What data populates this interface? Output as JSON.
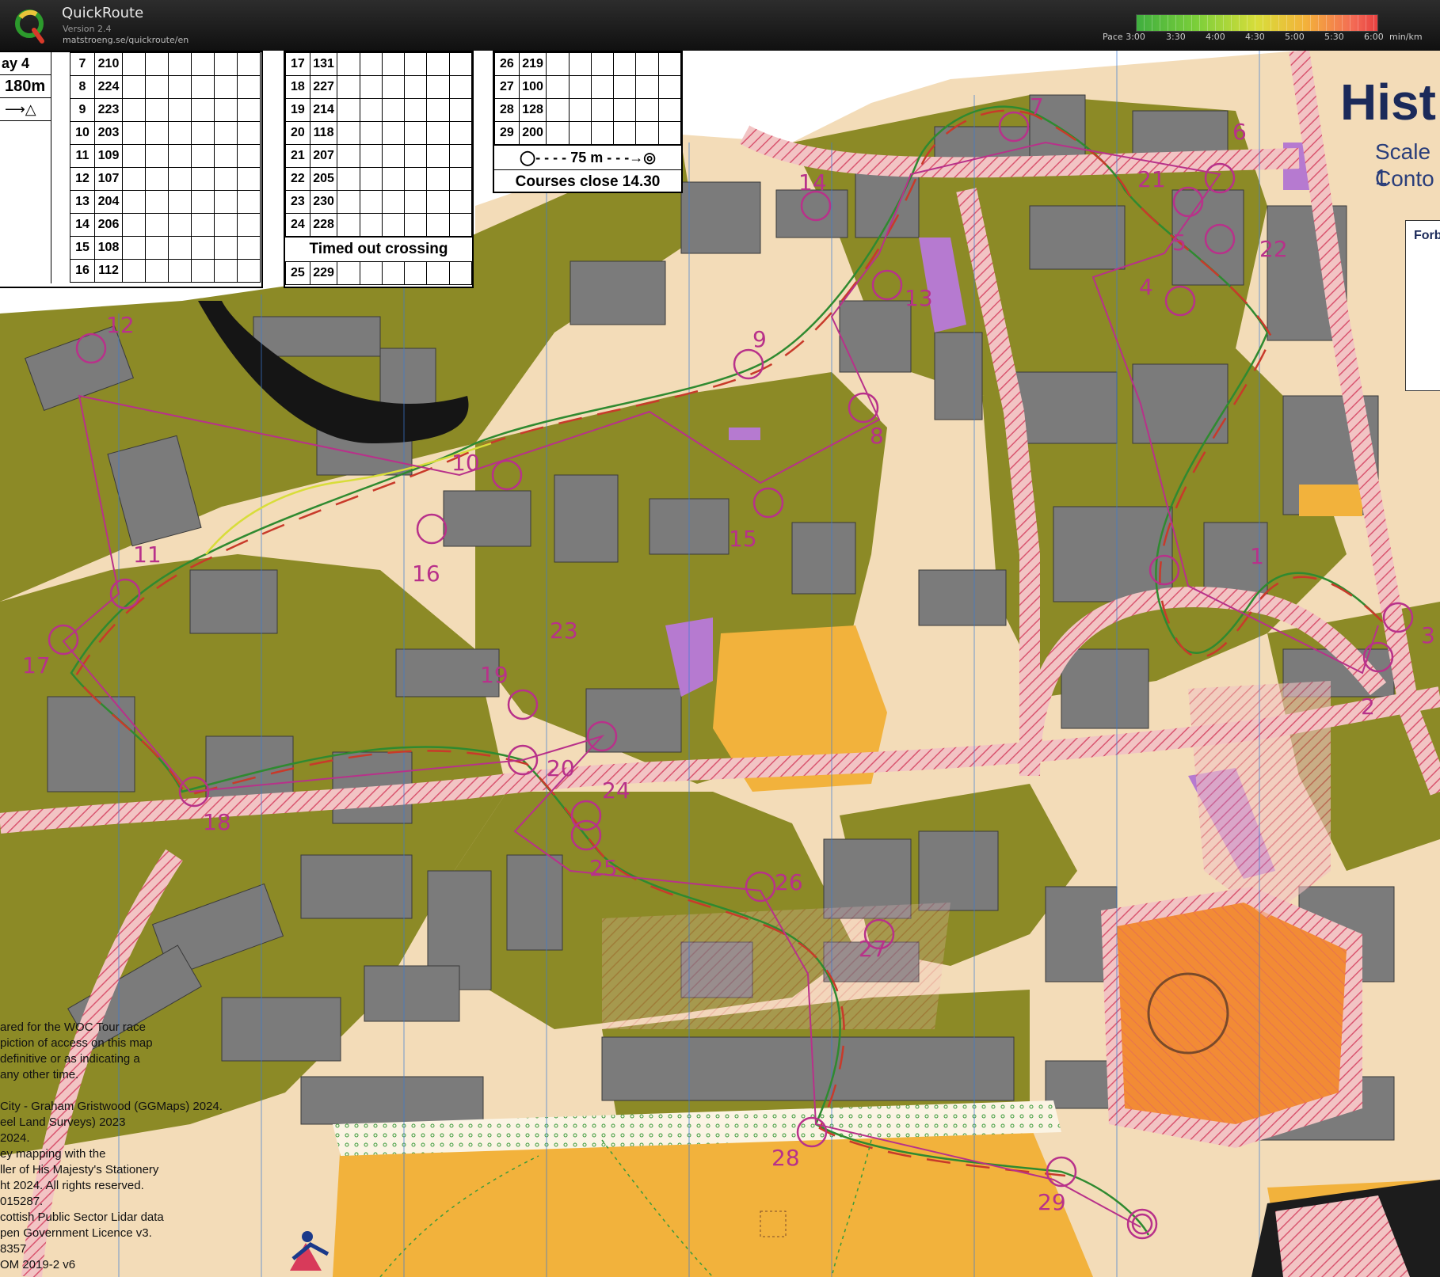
{
  "app": {
    "name": "QuickRoute",
    "version": "Version 2.4",
    "url": "matstroeng.se/quickroute/en"
  },
  "pace_scale": {
    "label": "Pace 3:00",
    "ticks": [
      "3:30",
      "4:00",
      "4:30",
      "5:00",
      "5:30",
      "6:00"
    ],
    "unit": "min/km",
    "colors": [
      "#3fae3f",
      "#d8dd3a",
      "#f3b23a",
      "#e84040"
    ]
  },
  "description_sheet_left": {
    "partial_header_1": "ay 4",
    "partial_header_2": "180m",
    "rows": [
      {
        "num": "7",
        "code": "210"
      },
      {
        "num": "8",
        "code": "224"
      },
      {
        "num": "9",
        "code": "223"
      },
      {
        "num": "10",
        "code": "203"
      },
      {
        "num": "11",
        "code": "109"
      },
      {
        "num": "12",
        "code": "107"
      },
      {
        "num": "13",
        "code": "204"
      },
      {
        "num": "14",
        "code": "206"
      },
      {
        "num": "15",
        "code": "108"
      },
      {
        "num": "16",
        "code": "112"
      }
    ]
  },
  "description_sheet_middle": {
    "rows": [
      {
        "num": "17",
        "code": "131"
      },
      {
        "num": "18",
        "code": "227"
      },
      {
        "num": "19",
        "code": "214"
      },
      {
        "num": "20",
        "code": "118"
      },
      {
        "num": "21",
        "code": "207"
      },
      {
        "num": "22",
        "code": "205"
      },
      {
        "num": "23",
        "code": "230"
      },
      {
        "num": "24",
        "code": "228"
      }
    ],
    "note": "Timed out crossing",
    "last_row": {
      "num": "25",
      "code": "229"
    }
  },
  "description_sheet_right": {
    "rows": [
      {
        "num": "26",
        "code": "219"
      },
      {
        "num": "27",
        "code": "100"
      },
      {
        "num": "28",
        "code": "128"
      },
      {
        "num": "29",
        "code": "200"
      }
    ],
    "finish_distance": "75 m",
    "closing_note": "Courses close 14.30"
  },
  "map_title": {
    "title": "Hist",
    "scale_partial": "Scale 1",
    "contour_partial": "Conto",
    "legend_partial": "Forb"
  },
  "controls": [
    "1",
    "2",
    "3",
    "4",
    "5",
    "6",
    "7",
    "8",
    "9",
    "10",
    "11",
    "12",
    "13",
    "14",
    "15",
    "16",
    "17",
    "18",
    "19",
    "20",
    "21",
    "22",
    "23",
    "24",
    "25",
    "26",
    "27",
    "28",
    "29"
  ],
  "credits": [
    "ared for the WOC Tour race",
    "piction of access on this map",
    "definitive or as indicating a",
    "any other time.",
    "",
    "City - Graham Gristwood (GGMaps) 2024.",
    "eel Land Surveys) 2023",
    "2024.",
    "ey mapping with the",
    "ller of His Majesty's Stationery",
    "ht 2024. All rights reserved.",
    "015287.",
    "cottish Public Sector Lidar data",
    "pen Government Licence v3.",
    "8357",
    "OM 2019-2 v6"
  ],
  "colors": {
    "vegetation": "#8c8a26",
    "building": "#7b7b7b",
    "paved": "#f3dcb8",
    "road_hatch": "#e0607a",
    "open_land": "#f2b23c",
    "course": "#b8318a",
    "route_green": "#2f8a30",
    "route_red": "#c83a2a"
  }
}
